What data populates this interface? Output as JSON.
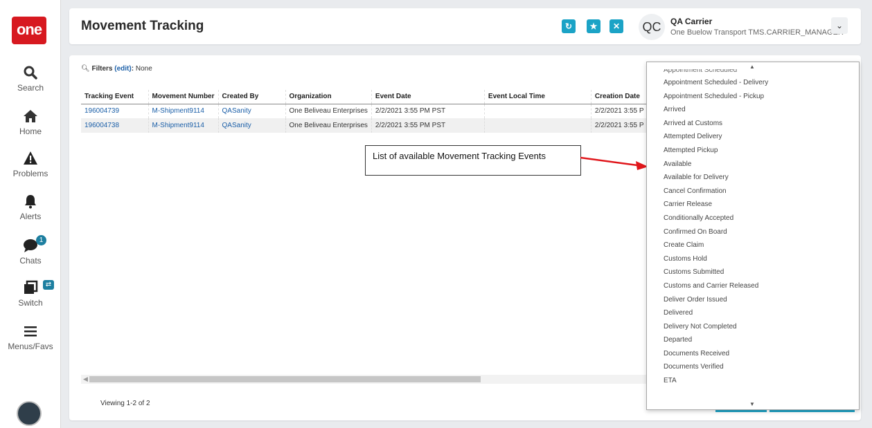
{
  "sidebar": {
    "logo": "one",
    "items": [
      {
        "label": "Search",
        "icon": "search-icon"
      },
      {
        "label": "Home",
        "icon": "home-icon"
      },
      {
        "label": "Problems",
        "icon": "warning-icon"
      },
      {
        "label": "Alerts",
        "icon": "bell-icon"
      },
      {
        "label": "Chats",
        "icon": "chat-icon",
        "badge": "1"
      },
      {
        "label": "Switch",
        "icon": "switch-icon"
      },
      {
        "label": "Menus/Favs",
        "icon": "menu-icon"
      }
    ]
  },
  "header": {
    "title": "Movement Tracking",
    "user_initials": "QC",
    "user_name": "QA Carrier",
    "user_org": "One Buelow Transport TMS.CARRIER_MANAGER"
  },
  "filters": {
    "label": "Filters",
    "edit": "(edit)",
    "value": "None"
  },
  "table": {
    "columns": [
      "Tracking Event",
      "Movement Number",
      "Created By",
      "Organization",
      "Event Date",
      "Event Local Time",
      "Creation Date"
    ],
    "rows": [
      [
        "196004739",
        "M-Shipment9114",
        "QASanity",
        "One Beliveau Enterprises",
        "2/2/2021 3:55 PM PST",
        "",
        "2/2/2021 3:55 P"
      ],
      [
        "196004738",
        "M-Shipment9114",
        "QASanity",
        "One Beliveau Enterprises",
        "2/2/2021 3:55 PM PST",
        "",
        "2/2/2021 3:55 P"
      ]
    ]
  },
  "viewing": "Viewing 1-2 of 2",
  "annotation": "List of available Movement Tracking Events",
  "dropdown": {
    "items": [
      "Appointment Scheduled",
      "Appointment Scheduled - Delivery",
      "Appointment Scheduled - Pickup",
      "Arrived",
      "Arrived at Customs",
      "Attempted Delivery",
      "Attempted Pickup",
      "Available",
      "Available for Delivery",
      "Cancel Confirmation",
      "Carrier Release",
      "Conditionally Accepted",
      "Confirmed On Board",
      "Create Claim",
      "Customs Hold",
      "Customs Submitted",
      "Customs and Carrier Released",
      "Deliver Order Issued",
      "Delivered",
      "Delivery Not Completed",
      "Departed",
      "Documents Received",
      "Documents Verified",
      "ETA"
    ]
  },
  "colors": {
    "accent": "#1ba3c6",
    "logo": "#d71920",
    "link": "#1b5fa8",
    "annotation_arrow": "#e0161b"
  }
}
